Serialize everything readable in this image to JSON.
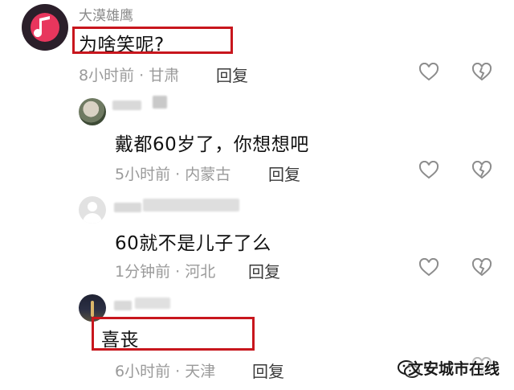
{
  "comments": [
    {
      "username": "大漠雄鹰",
      "text": "为啥笑呢?",
      "time": "8小时前",
      "location": "甘肃",
      "reply_label": "回复"
    },
    {
      "username": "",
      "text": "戴都60岁了，你想想吧",
      "time": "5小时前",
      "location": "内蒙古",
      "reply_label": "回复"
    },
    {
      "username": "",
      "text": "60就不是儿子了么",
      "time": "1分钟前",
      "location": "河北",
      "reply_label": "回复"
    },
    {
      "username": "",
      "text": "喜丧",
      "time": "6小时前",
      "location": "天津",
      "reply_label": "回复"
    }
  ],
  "separator": "·",
  "watermark": "文安城市在线",
  "icons": {
    "like": "heart-outline-icon",
    "dislike": "broken-heart-icon",
    "music_avatar": "music-note-icon",
    "wechat_watermark": "wechat-icon"
  },
  "colors": {
    "highlight_box": "#c8161d",
    "avatar_main": "#e8365d",
    "meta_text": "#9a9a9a"
  }
}
